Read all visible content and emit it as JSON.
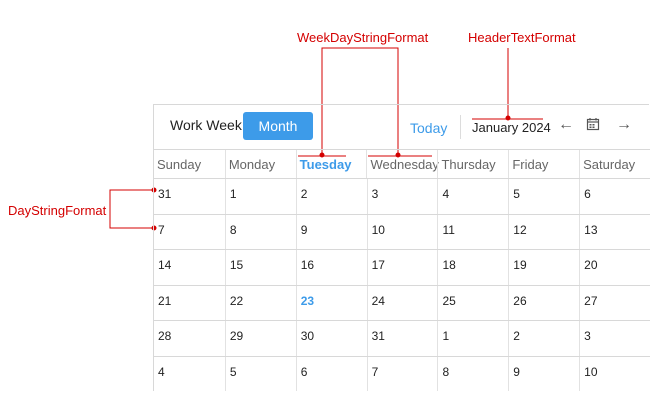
{
  "annotations": {
    "weekday_format": "WeekDayStringFormat",
    "header_format": "HeaderTextFormat",
    "day_format": "DayStringFormat"
  },
  "toolbar": {
    "work_week_label": "Work Week",
    "month_label": "Month",
    "today_label": "Today",
    "header_text": "January 2024",
    "prev_glyph": "←",
    "calendar_glyph": "▦",
    "next_glyph": "→"
  },
  "weekdays": [
    "Sunday",
    "Monday",
    "Tuesday",
    "Wednesday",
    "Thursday",
    "Friday",
    "Saturday"
  ],
  "weeks": [
    [
      "31",
      "1",
      "2",
      "3",
      "4",
      "5",
      "6"
    ],
    [
      "7",
      "8",
      "9",
      "10",
      "11",
      "12",
      "13"
    ],
    [
      "14",
      "15",
      "16",
      "17",
      "18",
      "19",
      "20"
    ],
    [
      "21",
      "22",
      "23",
      "24",
      "25",
      "26",
      "27"
    ],
    [
      "28",
      "29",
      "30",
      "31",
      "1",
      "2",
      "3"
    ],
    [
      "4",
      "5",
      "6",
      "7",
      "8",
      "9",
      "10"
    ]
  ],
  "colors": {
    "accent": "#3d9be9",
    "annotation": "#d40000"
  },
  "icons": [
    "arrow-left-icon",
    "calendar-icon",
    "arrow-right-icon"
  ]
}
